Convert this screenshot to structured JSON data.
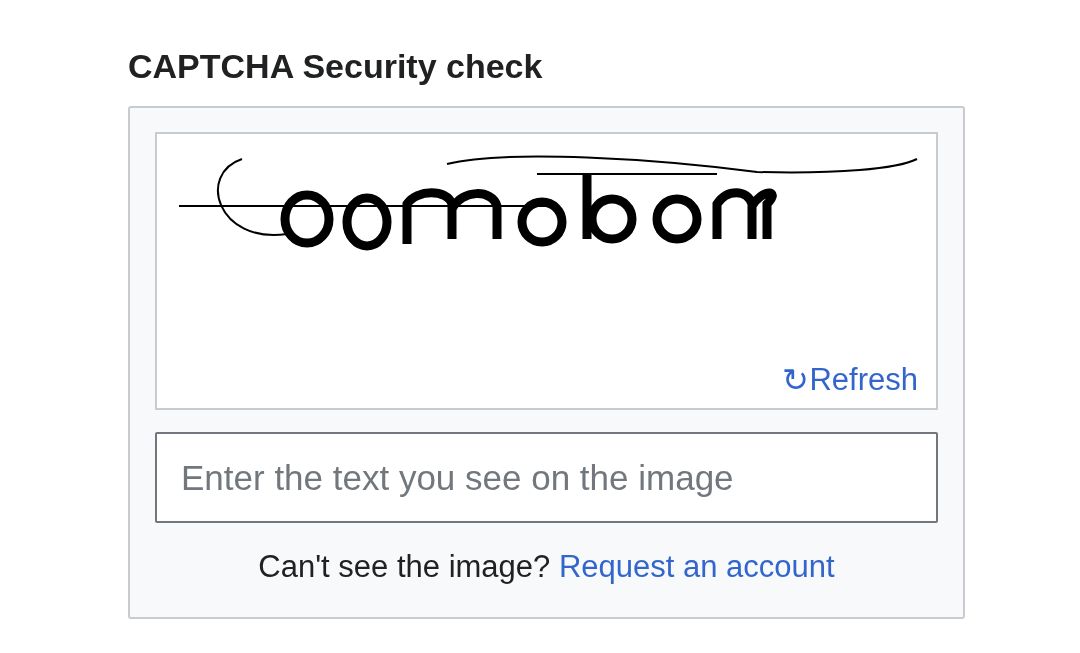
{
  "heading": "CAPTCHA Security check",
  "captcha": {
    "refresh": {
      "icon": "↻",
      "label": "Refresh"
    }
  },
  "answer_field": {
    "placeholder": "Enter the text you see on the image"
  },
  "footer": {
    "text": "Can't see the image?",
    "link": "Request an account"
  }
}
